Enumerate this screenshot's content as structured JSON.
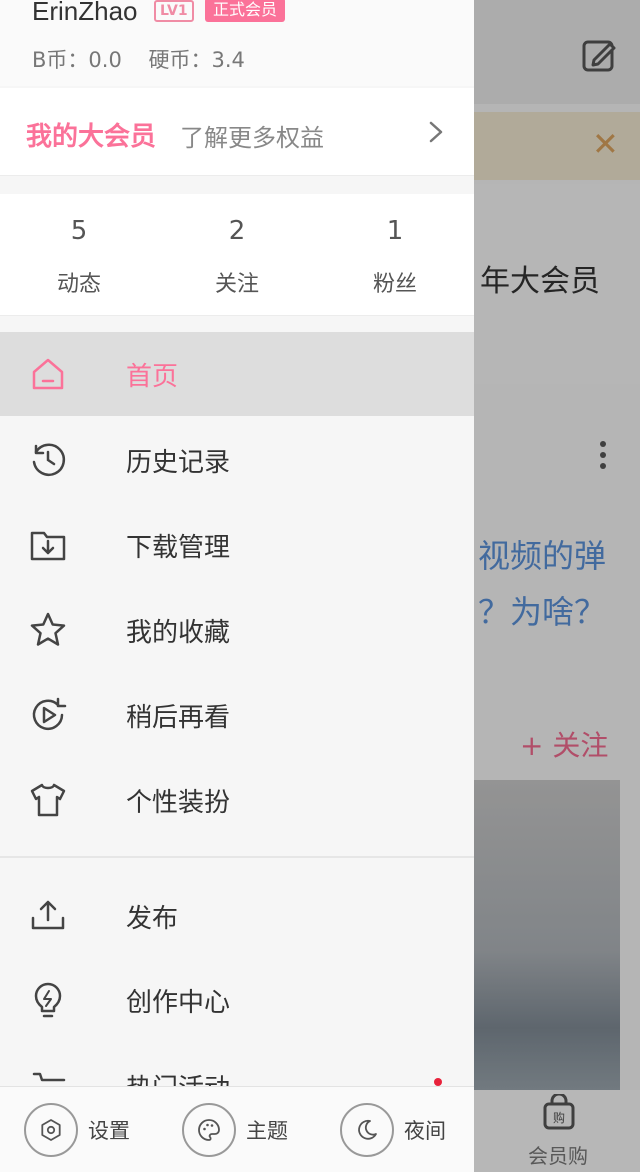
{
  "colors": {
    "accent": "#fb7299",
    "dim_overlay": "rgba(0,0,0,0.26)"
  },
  "background": {
    "banner_close_icon": "close-icon",
    "vip_text": "年大会员",
    "article_lines": [
      "视频的弹",
      "？为啥？"
    ],
    "follow_label": "+ 关注",
    "tab_label": "会员购"
  },
  "profile": {
    "username": "ErinZhao",
    "level": "LV1",
    "vip_tag": "正式会员",
    "bcoin": "B币：0.0",
    "coin": "硬币：3.4"
  },
  "vip": {
    "title": "我的大会员",
    "subtitle": "了解更多权益"
  },
  "stats": [
    {
      "value": "5",
      "label": "动态"
    },
    {
      "value": "2",
      "label": "关注"
    },
    {
      "value": "1",
      "label": "粉丝"
    }
  ],
  "menu": [
    {
      "label": "首页",
      "icon": "home-icon",
      "active": true
    },
    {
      "label": "历史记录",
      "icon": "history-icon"
    },
    {
      "label": "下载管理",
      "icon": "download-folder-icon"
    },
    {
      "label": "我的收藏",
      "icon": "star-icon"
    },
    {
      "label": "稍后再看",
      "icon": "watch-later-icon"
    },
    {
      "label": "个性装扮",
      "icon": "tshirt-icon"
    },
    {
      "label": "发布",
      "icon": "upload-icon"
    },
    {
      "label": "创作中心",
      "icon": "lightbulb-icon"
    },
    {
      "label": "热门活动",
      "icon": "cart-icon"
    }
  ],
  "bottom": {
    "settings": "设置",
    "theme": "主题",
    "night": "夜间"
  }
}
